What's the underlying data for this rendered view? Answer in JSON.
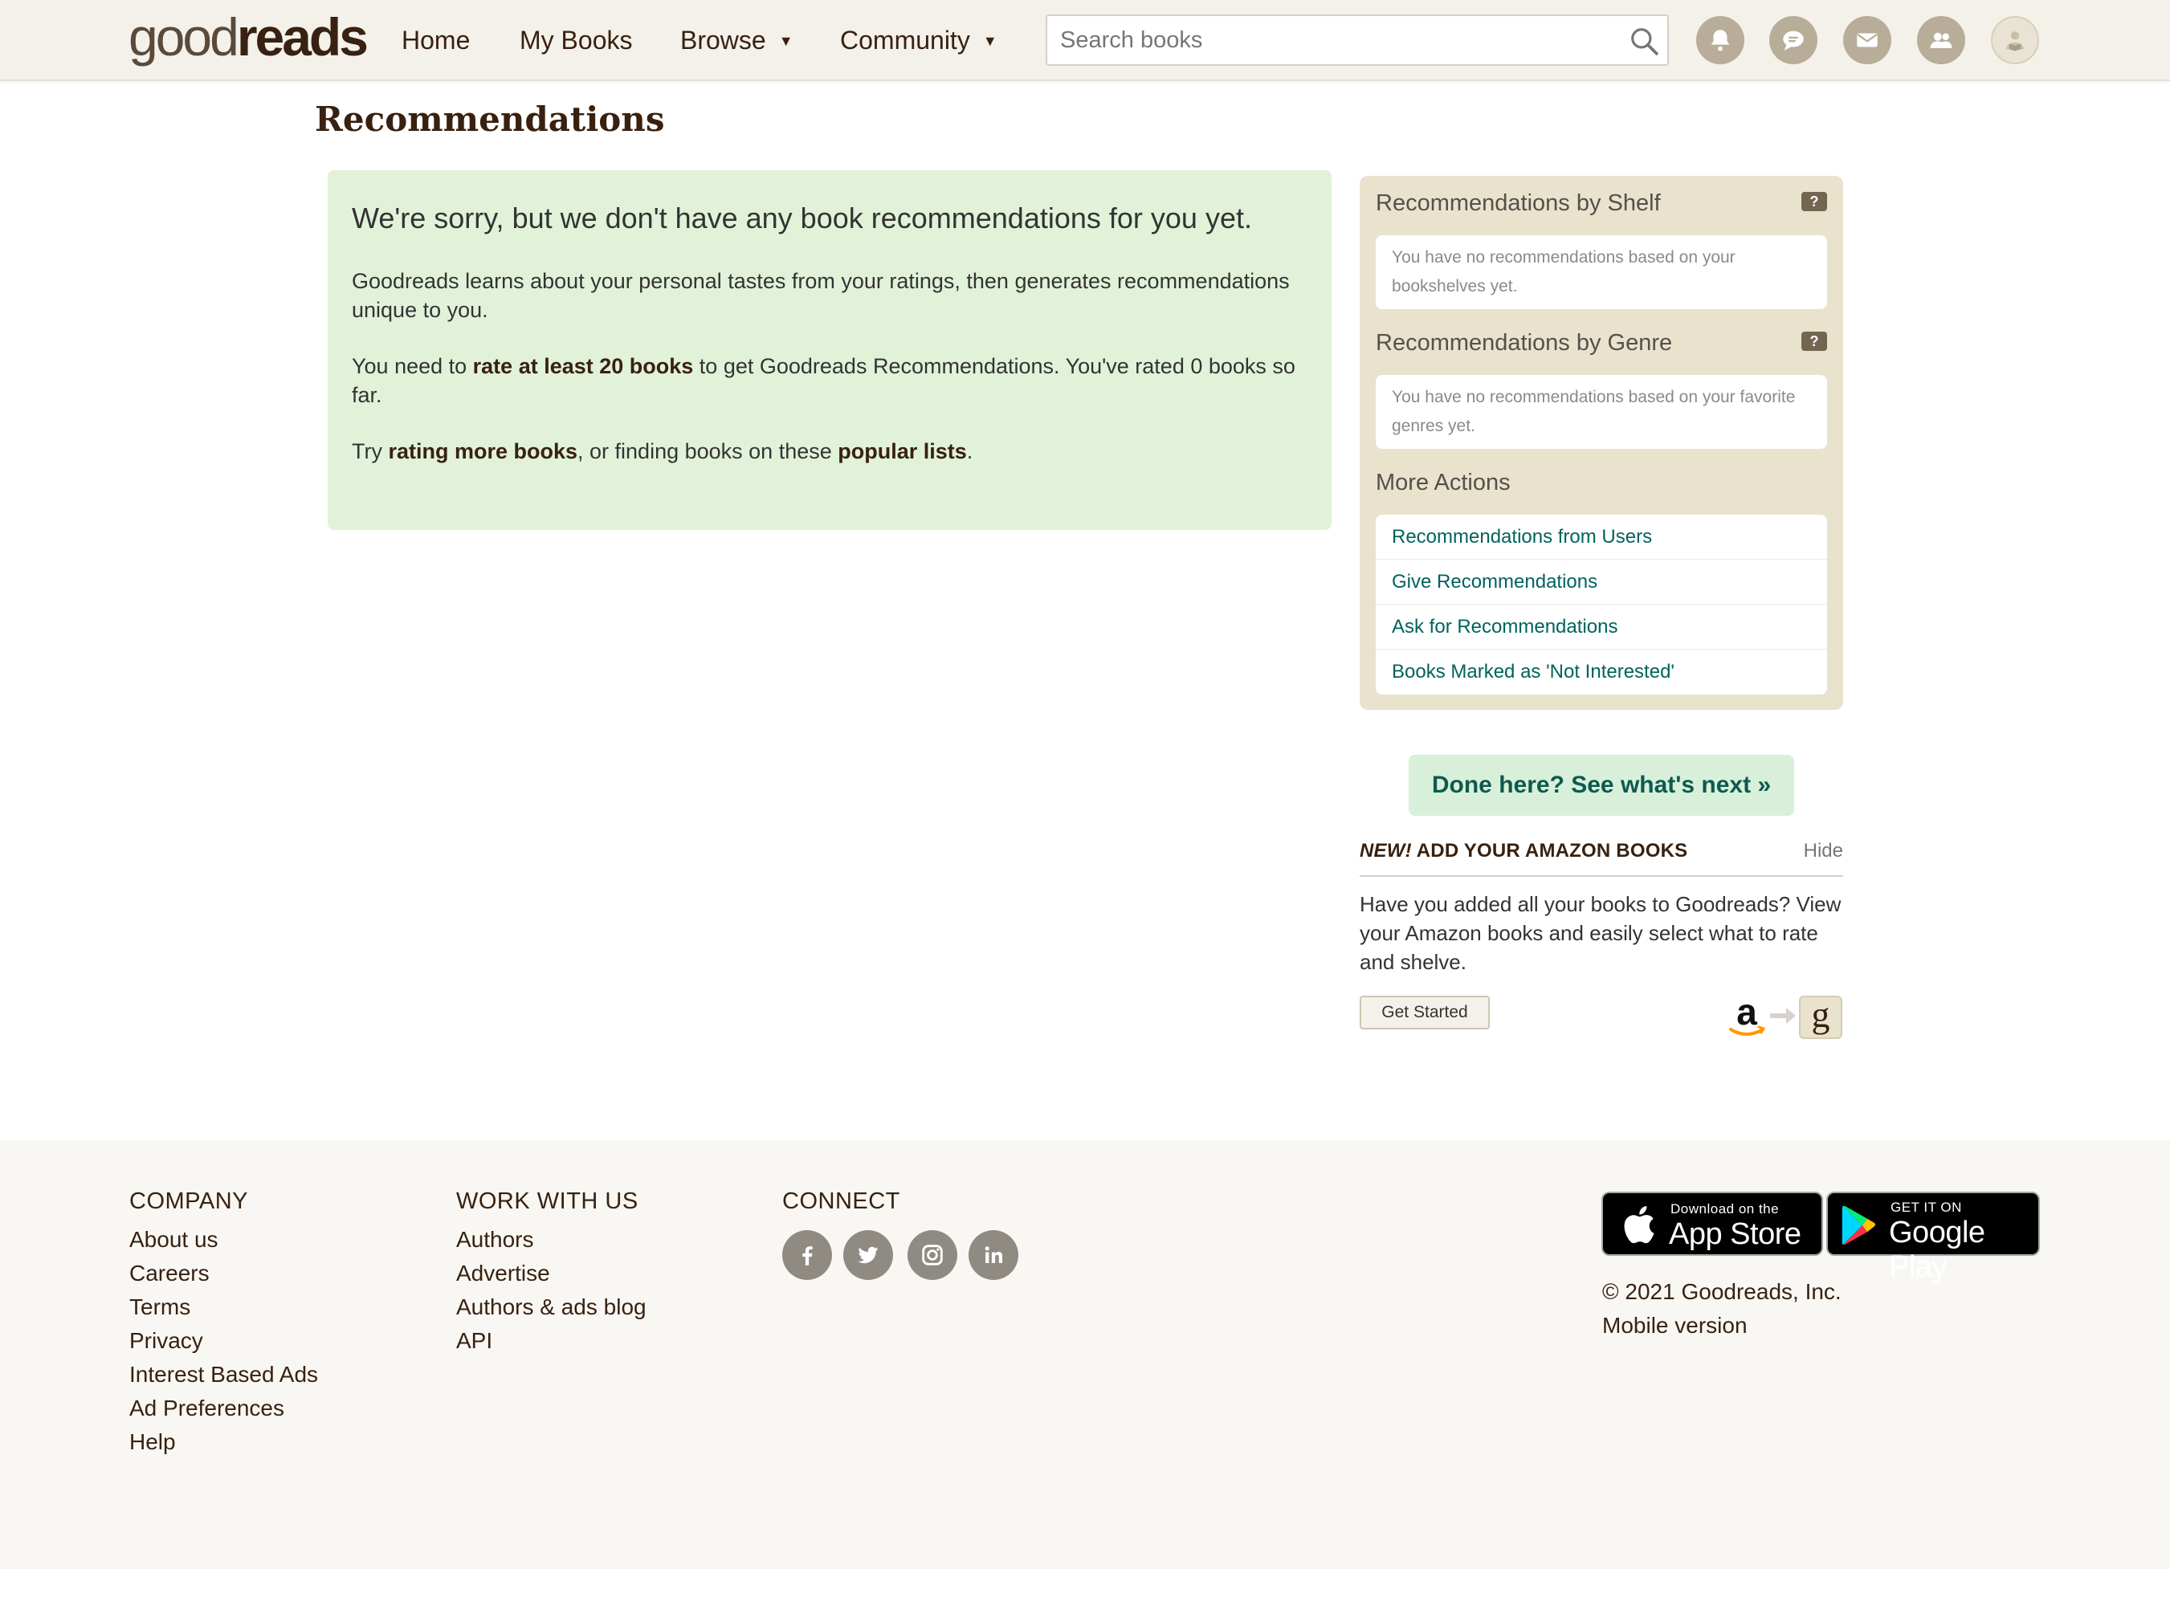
{
  "header": {
    "logo_light": "good",
    "logo_bold": "reads",
    "nav": {
      "home": "Home",
      "my_books": "My Books",
      "browse": "Browse",
      "community": "Community"
    },
    "search_placeholder": "Search books",
    "icons": [
      "bell-icon",
      "discussions-icon",
      "mail-icon",
      "friends-icon",
      "profile-avatar"
    ]
  },
  "page": {
    "title": "Recommendations"
  },
  "notice": {
    "headline": "We're sorry, but we don't have any book recommendations for you yet.",
    "p1": "Goodreads learns about your personal tastes from your ratings, then generates recommendations unique to you.",
    "p2_before": "You need to ",
    "p2_bold": "rate at least 20 books",
    "p2_after": " to get Goodreads Recommendations. You've rated 0 books so far.",
    "p3_before": "Try ",
    "p3_link1": "rating more books",
    "p3_mid": ", or finding books on these ",
    "p3_link2": "popular lists",
    "p3_end": "."
  },
  "sidebar": {
    "by_shelf_title": "Recommendations by Shelf",
    "by_shelf_text": "You have no recommendations based on your bookshelves yet.",
    "by_genre_title": "Recommendations by Genre",
    "by_genre_text": "You have no recommendations based on your favorite genres yet.",
    "help_badge": "?",
    "more_actions_title": "More Actions",
    "actions": [
      {
        "label": "Recommendations from Users"
      },
      {
        "label": "Give Recommendations"
      },
      {
        "label": "Ask for Recommendations"
      },
      {
        "label": "Books Marked as 'Not Interested'"
      }
    ]
  },
  "next_button": "Done here? See what's next »",
  "amazon": {
    "title_new": "NEW!",
    "title_rest": " ADD YOUR AMAZON BOOKS",
    "hide": "Hide",
    "body": "Have you added all your books to Goodreads? View your Amazon books and easily select what to rate and shelve.",
    "button": "Get Started",
    "amazon_letter": "a",
    "goodreads_letter": "g"
  },
  "footer": {
    "company": {
      "heading": "COMPANY",
      "links": [
        "About us",
        "Careers",
        "Terms",
        "Privacy",
        "Interest Based Ads",
        "Ad Preferences",
        "Help"
      ]
    },
    "work": {
      "heading": "WORK WITH US",
      "links": [
        "Authors",
        "Advertise",
        "Authors & ads blog",
        "API"
      ]
    },
    "connect": {
      "heading": "CONNECT",
      "social": [
        "facebook-icon",
        "twitter-icon",
        "instagram-icon",
        "linkedin-icon"
      ]
    },
    "app_store": {
      "small": "Download on the",
      "big": "App Store"
    },
    "google_play": {
      "small": "GET IT ON",
      "big": "Google Play"
    },
    "copyright": "© 2021 Goodreads, Inc.",
    "mobile_version": "Mobile version"
  }
}
